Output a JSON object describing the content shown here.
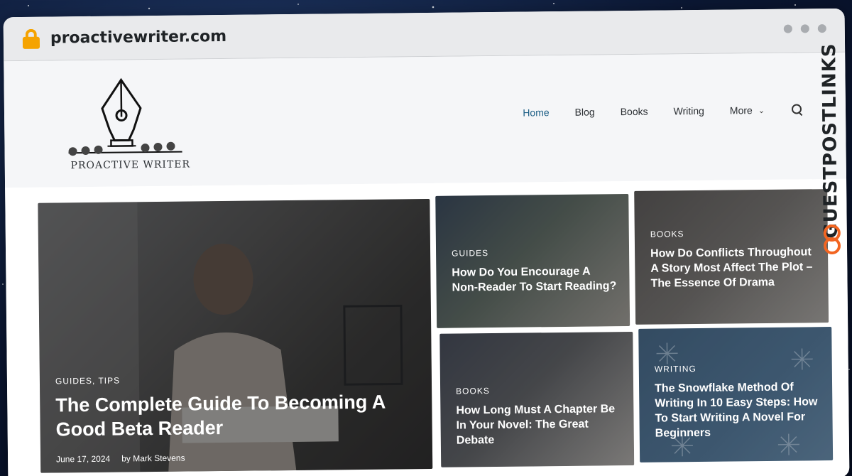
{
  "browser": {
    "url": "proactivewriter.com"
  },
  "site": {
    "logo_text": "PROACTIVE WRITER",
    "nav": [
      {
        "label": "Home",
        "active": true
      },
      {
        "label": "Blog"
      },
      {
        "label": "Books"
      },
      {
        "label": "Writing"
      },
      {
        "label": "More",
        "has_dropdown": true
      }
    ]
  },
  "featured": {
    "category": "GUIDES, TIPS",
    "title": "The Complete Guide To Becoming A Good Beta Reader",
    "date": "June 17, 2024",
    "author": "by Mark Stevens"
  },
  "posts": [
    {
      "category": "GUIDES",
      "title": "How Do You Encourage A Non-Reader To Start Reading?"
    },
    {
      "category": "BOOKS",
      "title": "How Do Conflicts Throughout A Story Most Affect The Plot – The Essence Of Drama"
    },
    {
      "category": "BOOKS",
      "title": "How Long Must A Chapter Be In Your Novel: The Great Debate"
    },
    {
      "category": "WRITING",
      "title": "The Snowflake Method Of Writing In 10 Easy Steps: How To Start Writing A Novel For Beginners"
    }
  ],
  "watermark": {
    "text": "GUESTPOSTLINKS"
  },
  "colors": {
    "nav_active": "#1d5f86",
    "lock": "#f5a300",
    "watermark_accent": "#f26522"
  }
}
